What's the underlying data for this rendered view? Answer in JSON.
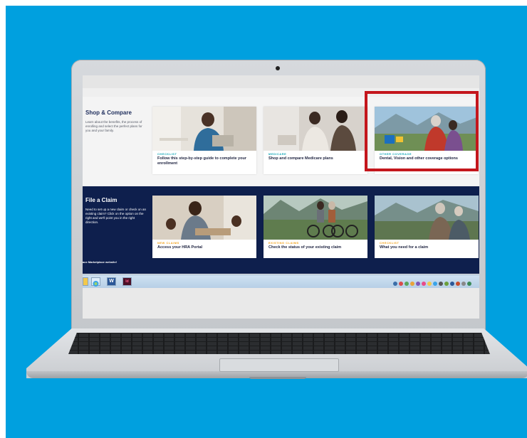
{
  "colors": {
    "background": "#00a0df",
    "navy": "#0e1f4d",
    "highlight": "#c4161c",
    "tag_teal": "#12a8b8",
    "tag_gold": "#f2a11a"
  },
  "shop": {
    "title": "Shop & Compare",
    "description": "Learn about the benefits, the process of enrolling and select the perfect plans for you and your family.",
    "cards": [
      {
        "tag": "CHECKLIST",
        "title": "Follow this step-by-step guide to complete your enrollment"
      },
      {
        "tag": "MEDICARE",
        "title": "Shop and compare Medicare plans"
      },
      {
        "tag": "OTHER COVERAGE",
        "title": "Dental, Vision and other coverage options"
      }
    ]
  },
  "claim": {
    "title": "File a Claim",
    "description": "Need to set up a new claim or check on an existing claim? Click on the option on the right and we'll point you in the right direction.",
    "footer_fragment": "ace Marketplace website!",
    "cards": [
      {
        "tag": "NEW CLAIMS",
        "title": "Access your HRA Portal"
      },
      {
        "tag": "EXISTING CLAIMS",
        "title": "Check the status of your existing claim"
      },
      {
        "tag": "CHECKLIST",
        "title": "What you need for a claim"
      }
    ]
  },
  "taskbar": {
    "icons": [
      "folder-icon",
      "browser-icon",
      "word-icon",
      "indesign-icon"
    ],
    "word_letter": "W",
    "indesign_letter": "Id"
  }
}
